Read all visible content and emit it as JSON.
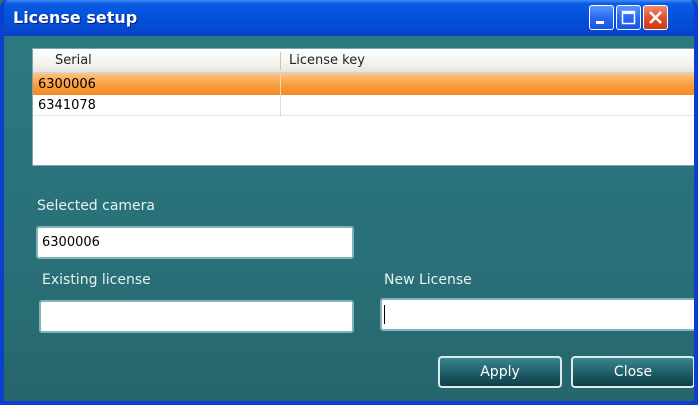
{
  "window": {
    "title": "License setup"
  },
  "table": {
    "columns": [
      "Serial",
      "License key"
    ],
    "rows": [
      {
        "serial": "6300006",
        "license_key": "",
        "selected": true
      },
      {
        "serial": "6341078",
        "license_key": "",
        "selected": false
      }
    ]
  },
  "form": {
    "selected_camera_label": "Selected camera",
    "selected_camera_value": "6300006",
    "existing_license_label": "Existing license",
    "existing_license_value": "",
    "new_license_label": "New License",
    "new_license_value": ""
  },
  "buttons": {
    "apply": "Apply",
    "close": "Close"
  },
  "colors": {
    "title_bar": "#0552db",
    "background": "#2c737c",
    "selected_row": "#f99d3e",
    "close_button": "#e0512f"
  },
  "icons": {
    "minimize": "minimize-icon",
    "maximize": "maximize-icon",
    "close": "close-icon"
  }
}
